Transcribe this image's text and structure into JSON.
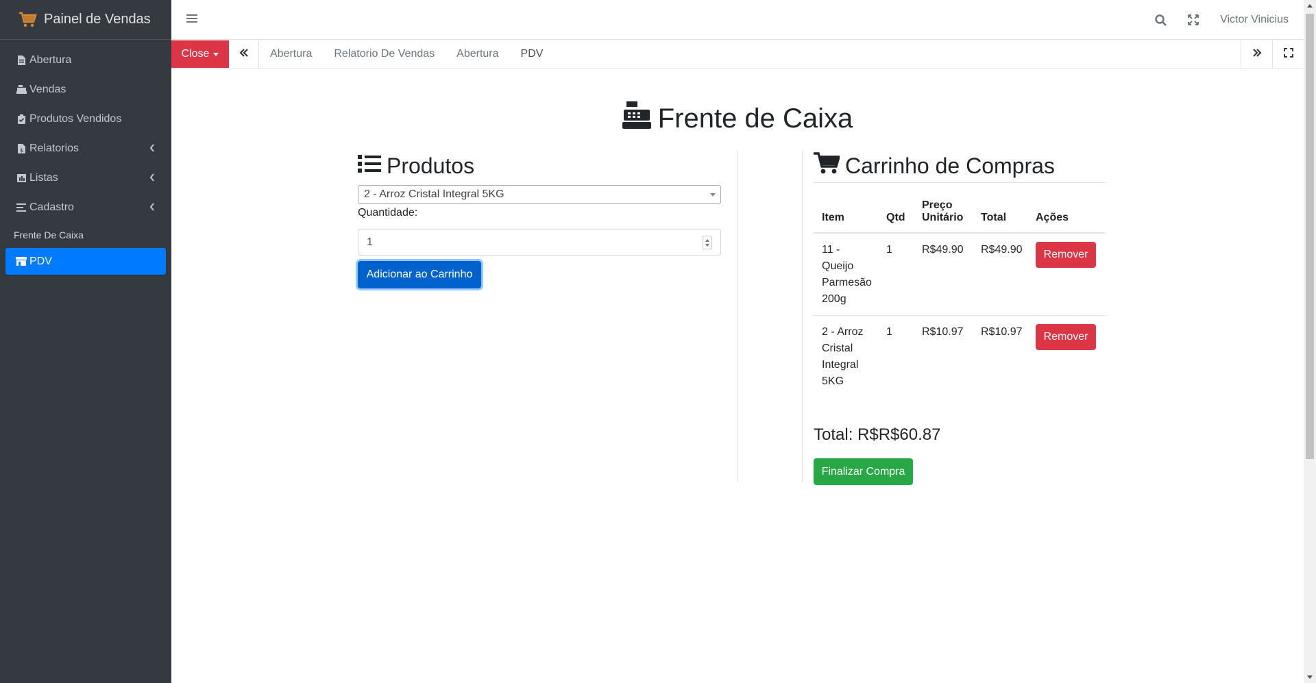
{
  "brand": {
    "title": "Painel de Vendas"
  },
  "sidebar": {
    "items": [
      {
        "label": "Abertura",
        "icon": "file-invoice-icon"
      },
      {
        "label": "Vendas",
        "icon": "cash-register-icon"
      },
      {
        "label": "Produtos Vendidos",
        "icon": "clipboard-check-icon"
      },
      {
        "label": "Relatorios",
        "icon": "file-invoice-dollar-icon",
        "has_children": true
      },
      {
        "label": "Listas",
        "icon": "chart-bar-icon",
        "has_children": true
      },
      {
        "label": "Cadastro",
        "icon": "list-icon",
        "has_children": true
      }
    ],
    "header": "Frente De Caixa",
    "active_item": {
      "label": "PDV",
      "icon": "store-icon"
    }
  },
  "topbar": {
    "user_name": "Victor Vinicius"
  },
  "tabs": {
    "close_label": "Close",
    "items": [
      "Abertura",
      "Relatorio De Vendas",
      "Abertura",
      "PDV"
    ],
    "active_index": 3
  },
  "page": {
    "title": "Frente de Caixa"
  },
  "products": {
    "heading": "Produtos",
    "selected_product": "2 - Arroz Cristal Integral 5KG",
    "quantity_label": "Quantidade:",
    "quantity_value": "1",
    "add_button": "Adicionar ao Carrinho"
  },
  "cart": {
    "heading": "Carrinho de Compras",
    "columns": {
      "item": "Item",
      "qtd": "Qtd",
      "preco": "Preço Unitário",
      "total": "Total",
      "acoes": "Ações"
    },
    "rows": [
      {
        "item": "11 - Queijo Parmesão 200g",
        "qtd": "1",
        "preco": "R$49.90",
        "total": "R$49.90",
        "action": "Remover"
      },
      {
        "item": "2 - Arroz Cristal Integral 5KG",
        "qtd": "1",
        "preco": "R$10.97",
        "total": "R$10.97",
        "action": "Remover"
      }
    ],
    "total_text": "Total: R$R$60.87",
    "finish_button": "Finalizar Compra"
  },
  "colors": {
    "sidebar_bg": "#343a40",
    "primary": "#007bff",
    "danger": "#dc3545",
    "success": "#28a745"
  }
}
